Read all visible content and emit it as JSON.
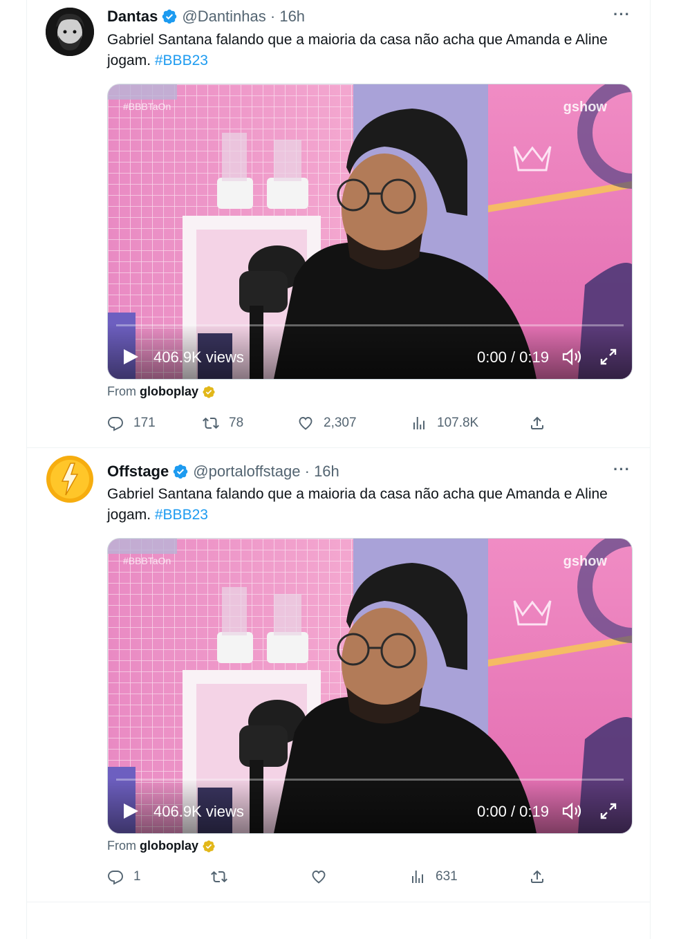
{
  "tweets": [
    {
      "name": "Dantas",
      "handle": "@Dantinhas",
      "time": "16h",
      "text": "Gabriel Santana falando que a maioria da casa não acha que Amanda e Aline jogam.",
      "hashtag": "#BBB23",
      "video": {
        "views": "406.9K views",
        "time": "0:00 / 0:19",
        "watermark_tag": "#BBBTaOn",
        "watermark_brand": "gshow",
        "progress": 0
      },
      "from_prefix": "From",
      "from_source": "globoplay",
      "replies": "171",
      "retweets": "78",
      "likes": "2,307",
      "views": "107.8K"
    },
    {
      "name": "Offstage",
      "handle": "@portaloffstage",
      "time": "16h",
      "text": "Gabriel Santana falando que a maioria da casa não acha que Amanda e Aline jogam.",
      "hashtag": "#BBB23",
      "video": {
        "views": "406.9K views",
        "time": "0:00 / 0:19",
        "watermark_tag": "#BBBTaOn",
        "watermark_brand": "gshow",
        "progress": 0
      },
      "from_prefix": "From",
      "from_source": "globoplay",
      "replies": "1",
      "retweets": "",
      "likes": "",
      "views": "631"
    }
  ],
  "icons": {
    "verified": "verified-badge-icon",
    "gold": "gold-verified-badge-icon",
    "reply": "reply-icon",
    "retweet": "retweet-icon",
    "like": "heart-icon",
    "views": "analytics-icon",
    "share": "share-icon"
  },
  "colors": {
    "link": "#1d9bf0",
    "secondary": "#536471",
    "verified": "#1d9bf0",
    "gold": "#e2b719"
  }
}
